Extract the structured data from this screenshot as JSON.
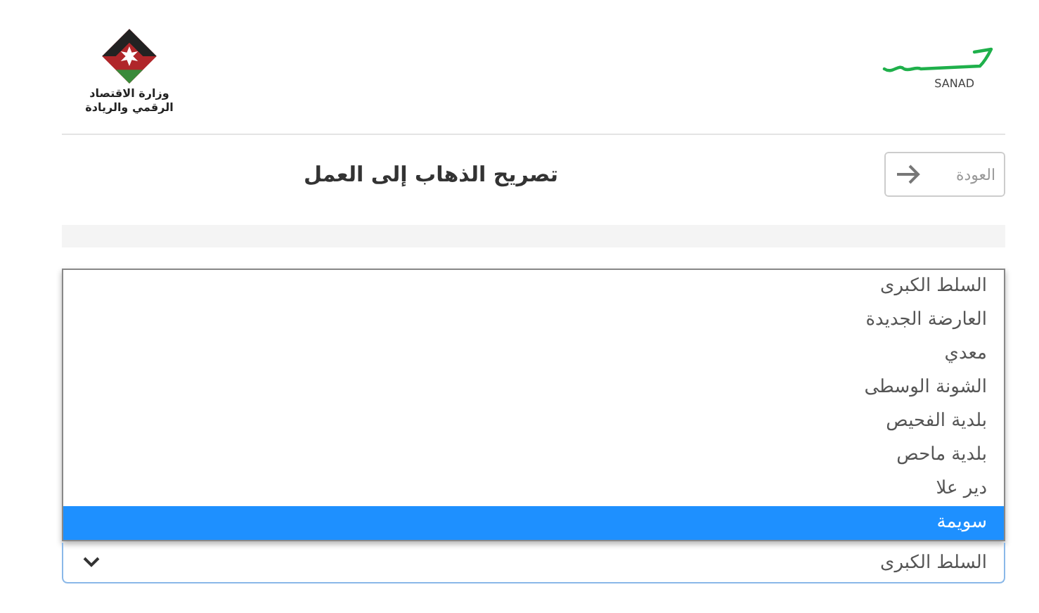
{
  "header": {
    "ministry_logo_lines": [
      "وزارة الاقتصاد",
      "الرقمي والريادة"
    ],
    "sanad_logo_text": "SANAD"
  },
  "toolbar": {
    "back_button": "العودة",
    "title": "تصريح الذهاب إلى العمل"
  },
  "dropdown": {
    "options": [
      {
        "label": "السلط الكبرى",
        "selected": false
      },
      {
        "label": "العارضة الجديدة",
        "selected": false
      },
      {
        "label": "معدي",
        "selected": false
      },
      {
        "label": "الشونة الوسطى",
        "selected": false
      },
      {
        "label": "بلدية الفحيص",
        "selected": false
      },
      {
        "label": "بلدية ماحص",
        "selected": false
      },
      {
        "label": "دير علا",
        "selected": false
      },
      {
        "label": "سويمة",
        "selected": true
      }
    ]
  },
  "select": {
    "value": "السلط الكبرى"
  }
}
